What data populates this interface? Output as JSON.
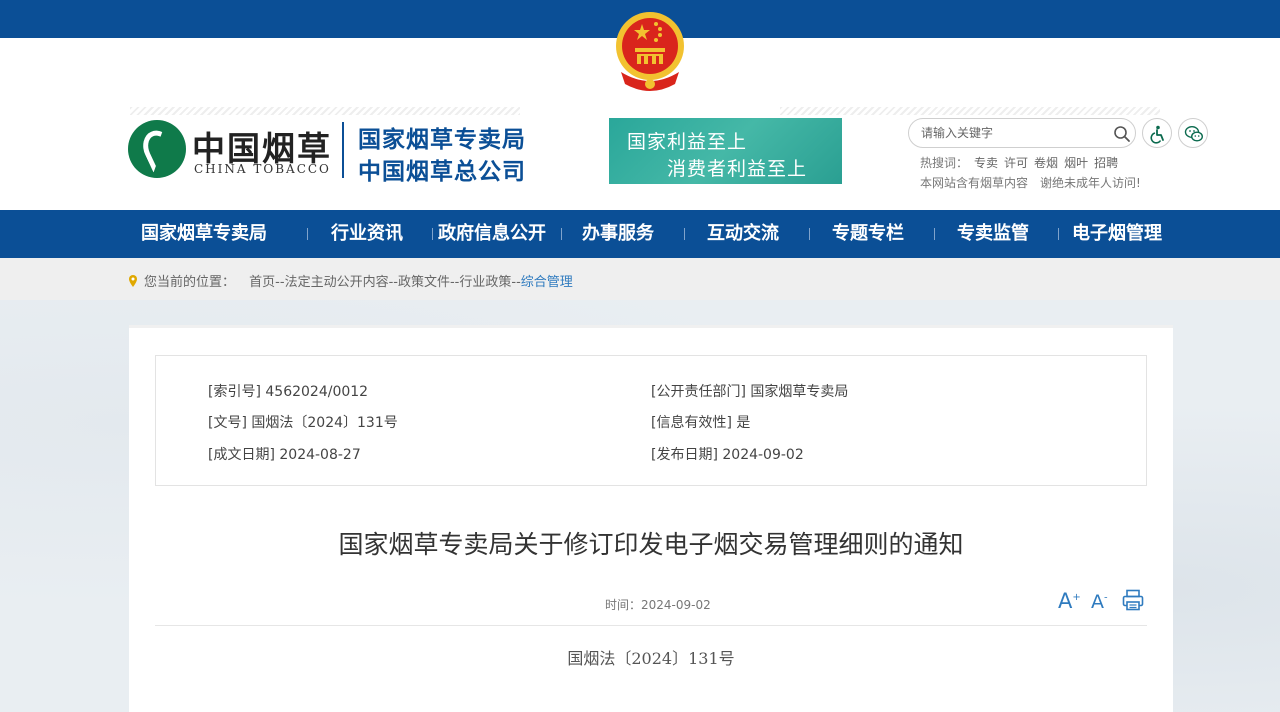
{
  "header": {
    "logo_cn": "中国烟草",
    "logo_en": "CHINA TOBACCO",
    "org_name_1": "国家烟草专卖局",
    "org_name_2": "中国烟草总公司",
    "slogan_1": "国家利益至上",
    "slogan_2": "消费者利益至上",
    "search_placeholder": "请输入关键字",
    "hot_label": "热搜词：",
    "hot_words": [
      "专卖",
      "许可",
      "卷烟",
      "烟叶",
      "招聘"
    ],
    "notice_1": "本网站含有烟草内容",
    "notice_2": "谢绝未成年人访问!"
  },
  "nav": {
    "items": [
      "国家烟草专卖局",
      "行业资讯",
      "政府信息公开",
      "办事服务",
      "互动交流",
      "专题专栏",
      "专卖监管",
      "电子烟管理"
    ]
  },
  "breadcrumb": {
    "label": "您当前的位置：",
    "items": [
      "首页",
      "法定主动公开内容",
      "政策文件",
      "行业政策",
      "综合管理"
    ],
    "separator": "--"
  },
  "meta": {
    "index_no": "[索引号] 4562024/0012",
    "department": "[公开责任部门] 国家烟草专卖局",
    "doc_no": "[文号] 国烟法〔2024〕131号",
    "validity": "[信息有效性] 是",
    "created_date": "[成文日期] 2024-08-27",
    "publish_date": "[发布日期] 2024-09-02"
  },
  "article": {
    "title": "国家烟草专卖局关于修订印发电子烟交易管理细则的通知",
    "time_label": "时间：2024-09-02",
    "font_plus": "A",
    "font_minus": "A",
    "doc_number": "国烟法〔2024〕131号"
  },
  "colors": {
    "primary_blue": "#0b4f96",
    "brand_green": "#0f7a4a",
    "slogan_teal": "#2aa79a",
    "link_blue": "#2f7bbf"
  }
}
